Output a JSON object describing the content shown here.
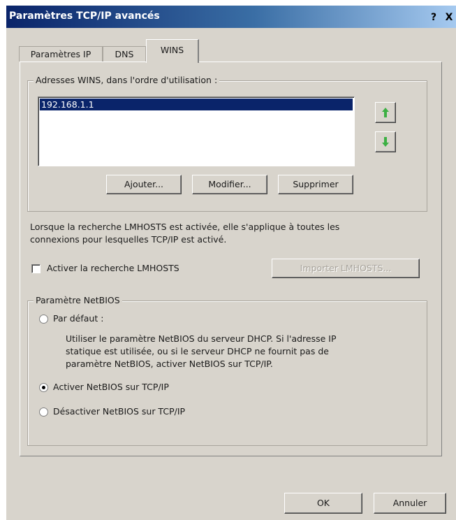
{
  "window": {
    "title": "Paramètres TCP/IP avancés",
    "help_glyph": "?",
    "close_glyph": "X"
  },
  "tabs": [
    {
      "label": "Paramètres IP",
      "active": false
    },
    {
      "label": "DNS",
      "active": false
    },
    {
      "label": "WINS",
      "active": true
    }
  ],
  "wins_group": {
    "label": "Adresses WINS, dans l'ordre d'utilisation :",
    "addresses": [
      "192.168.1.1"
    ],
    "selected": "192.168.1.1",
    "up_icon": "arrow-up-icon",
    "down_icon": "arrow-down-icon",
    "add_label": "Ajouter...",
    "edit_label": "Modifier...",
    "remove_label": "Supprimer"
  },
  "lmhosts": {
    "description_line1": "Lorsque la recherche LMHOSTS est activée, elle s'applique à toutes les",
    "description_line2": "connexions pour lesquelles TCP/IP est activé.",
    "checkbox_label": "Activer la recherche LMHOSTS",
    "checked": false,
    "import_label": "Importer LMHOSTS...",
    "import_enabled": false
  },
  "netbios_group": {
    "label": "Paramètre NetBIOS",
    "options": [
      {
        "label": "Par défaut :",
        "selected": false
      },
      {
        "label": "Activer NetBIOS sur TCP/IP",
        "selected": true
      },
      {
        "label": "Désactiver NetBIOS sur TCP/IP",
        "selected": false
      }
    ],
    "default_help_line1": "Utiliser le paramètre NetBIOS du serveur DHCP. Si l'adresse IP",
    "default_help_line2": "statique est utilisée, ou si le serveur DHCP ne fournit pas de",
    "default_help_line3": "paramètre NetBIOS, activer NetBIOS sur TCP/IP."
  },
  "footer": {
    "ok_label": "OK",
    "cancel_label": "Annuler"
  },
  "colors": {
    "selection": "#0a246a",
    "arrow": "#3cb043",
    "face": "#d8d4cc"
  }
}
